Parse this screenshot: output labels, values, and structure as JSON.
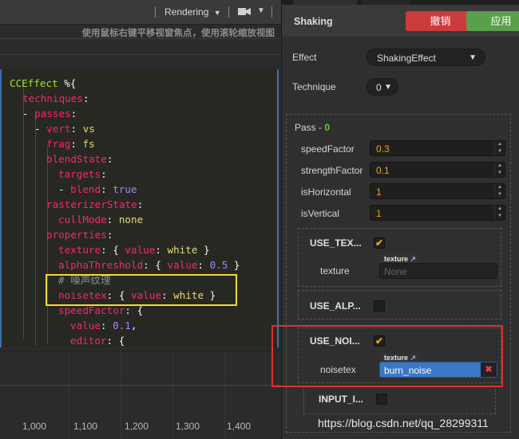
{
  "scene": {
    "toolbar": {
      "rendering_label": "Rendering",
      "rendering_caret": "▼",
      "camera_caret": "▼"
    },
    "hint": "使用鼠标右键平移视窗焦点，使用滚轮缩放视图"
  },
  "code": {
    "l1a": "CCEffect",
    "l1b": " %{",
    "l2": "techniques",
    "l2c": ":",
    "l3a": "- ",
    "l3b": "passes",
    "l3c": ":",
    "l4a": "- ",
    "l4b": "vert",
    "l4c": ": ",
    "l4d": "vs",
    "l5a": "frag",
    "l5b": ": ",
    "l5c": "fs",
    "l6a": "blendState",
    "l6b": ":",
    "l7a": "targets",
    "l7b": ":",
    "l8a": "- ",
    "l8b": "blend",
    "l8c": ": ",
    "l8d": "true",
    "l9a": "rasterizerState",
    "l9b": ":",
    "l10a": "cullMode",
    "l10b": ": ",
    "l10c": "none",
    "l11a": "properties",
    "l11b": ":",
    "l12a": "texture",
    "l12b": ": { ",
    "l12c": "value",
    "l12d": ": ",
    "l12e": "white",
    "l12f": " }",
    "l13a": "alphaThreshold",
    "l13b": ": { ",
    "l13c": "value",
    "l13d": ": ",
    "l13e": "0.5",
    "l13f": " }",
    "l14": "# 噪声纹理",
    "l15a": "noisetex",
    "l15b": ": { ",
    "l15c": "value",
    "l15d": ": ",
    "l15e": "white",
    "l15f": " }",
    "l16a": "speedFactor",
    "l16b": ": {",
    "l17a": "value",
    "l17b": ": ",
    "l17c": "0.1",
    "l17d": ",",
    "l18a": "editor",
    "l18b": ": {"
  },
  "timeline": {
    "ticks": [
      "1,000",
      "1,100",
      "1,200",
      "1,300",
      "1,400"
    ]
  },
  "inspector": {
    "title": "Shaking",
    "revert_label": "撤销",
    "apply_label": "应用",
    "effect_label": "Effect",
    "effect_value": "ShakingEffect",
    "technique_label": "Technique",
    "technique_value": "0",
    "pass_label": "Pass - ",
    "pass_index": "0",
    "props": [
      {
        "label": "speedFactor",
        "value": "0.3"
      },
      {
        "label": "strengthFactor",
        "value": "0.1"
      },
      {
        "label": "isHorizontal",
        "value": "1"
      },
      {
        "label": "isVertical",
        "value": "1"
      }
    ],
    "defines": [
      {
        "label": "USE_TEX...",
        "checked": true,
        "sub_label": "texture",
        "asset_tag": "texture",
        "asset_value": "None"
      },
      {
        "label": "USE_ALP...",
        "checked": false
      },
      {
        "label": "USE_NOI...",
        "checked": true,
        "sub_label": "noisetex",
        "asset_tag": "texture",
        "asset_value": "burn_noise"
      },
      {
        "label": "INPUT_I...",
        "checked": false
      }
    ],
    "colors": {
      "revert": "#cc3b3b",
      "apply": "#5aa04a",
      "number": "#f0a020",
      "asset_selected": "#3b78c4"
    }
  },
  "watermark": "https://blog.csdn.net/qq_28299311"
}
